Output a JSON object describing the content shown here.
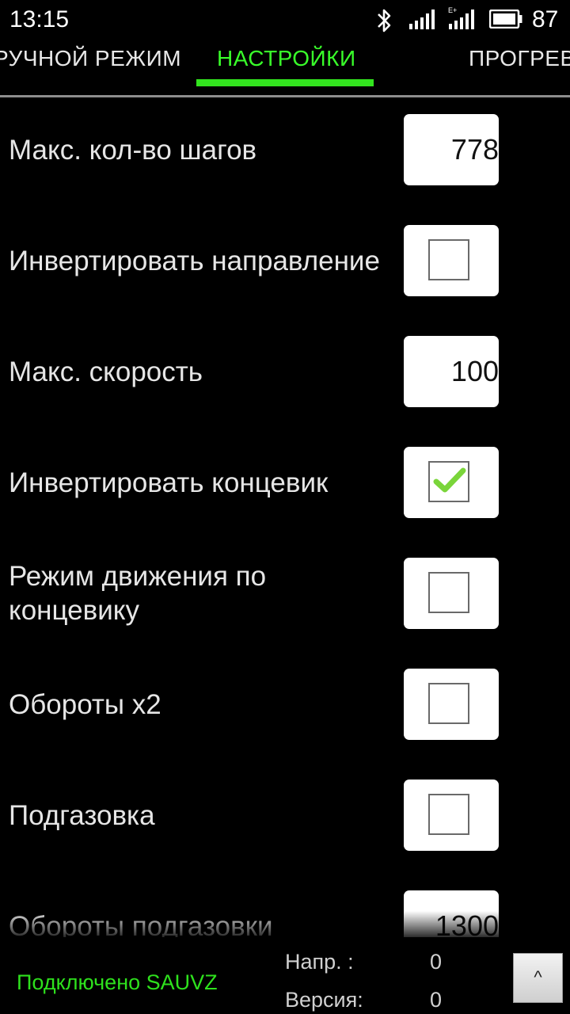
{
  "status_bar": {
    "time": "13:15",
    "battery_percent": "87",
    "icons": [
      "bluetooth-icon",
      "signal-icon",
      "data-signal-icon",
      "battery-icon"
    ]
  },
  "tabs": [
    {
      "label": "РУЧНОЙ РЕЖИМ",
      "active": false
    },
    {
      "label": "НАСТРОЙКИ",
      "active": true
    },
    {
      "label": "ПРОГРЕВ",
      "active": false
    }
  ],
  "accent_color": "#32e41e",
  "settings": {
    "max_steps": {
      "label": "Макс. кол-во шагов",
      "value": "778"
    },
    "invert_direction": {
      "label": "Инвертировать направление",
      "checked": false
    },
    "max_speed": {
      "label": "Макс. скорость",
      "value": "100"
    },
    "invert_limit_switch": {
      "label": "Инвертировать концевик",
      "checked": true
    },
    "limit_switch_mode": {
      "label": "Режим движения по концевику",
      "checked": false
    },
    "rpm_x2": {
      "label": "Обороты x2",
      "checked": false
    },
    "throttle": {
      "label": "Подгазовка",
      "checked": false
    },
    "throttle_rpm": {
      "label": "Обороты подгазовки",
      "value": "1300"
    }
  },
  "footer": {
    "connection_status": "Подключено SAUVZ",
    "voltage_label": "Напр. :",
    "voltage_value": "0",
    "version_label": "Версия:",
    "version_value": "0",
    "up_button_label": "^"
  }
}
